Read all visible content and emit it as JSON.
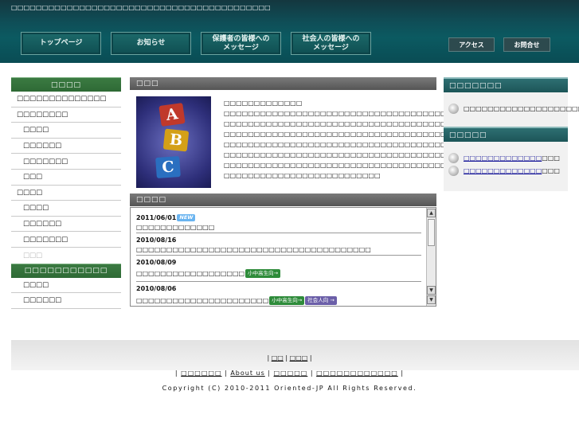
{
  "header": {
    "tagline": "□□□□□□□□□□□□□□□□□□□□□□□□□□□□□□□□□□□□□□□□□□",
    "nav": [
      {
        "label": "トップページ"
      },
      {
        "label": "お知らせ"
      },
      {
        "label_line1": "保護者の皆様への",
        "label_line2": "メッセージ"
      },
      {
        "label_line1": "社会人の皆様への",
        "label_line2": "メッセージ"
      }
    ],
    "access": "アクセス",
    "contact": "お問合せ"
  },
  "left_sidebar": {
    "heading": "□□□□",
    "items": [
      {
        "label": "□□□□□□□□□□□□□□",
        "style": "plain"
      },
      {
        "label": "□□□□□□□□",
        "style": "bold"
      },
      {
        "label": "□□□□",
        "style": "sub"
      },
      {
        "label": "□□□□□□",
        "style": "sub"
      },
      {
        "label": "□□□□□□□",
        "style": "sub"
      },
      {
        "label": "□□□",
        "style": "sub"
      },
      {
        "label": "□□□□",
        "style": "bold"
      },
      {
        "label": "□□□□",
        "style": "sub"
      },
      {
        "label": "□□□□□□",
        "style": "sub"
      },
      {
        "label": "□□□□□□□",
        "style": "sub"
      },
      {
        "label": "□□□",
        "style": "sub-disabled"
      }
    ],
    "heading2": "□□□□□□□□□□□",
    "items2": [
      {
        "label": "□□□□"
      },
      {
        "label": "□□□□□□"
      }
    ]
  },
  "center": {
    "greeting_heading": "□□□",
    "greeting_image_letters": [
      "A",
      "B",
      "C"
    ],
    "greeting_lines": [
      "□□□□□□□□□□□□□",
      "□□□□□□□□□□□□□□□□□□□□□□□□□□□□□□□□□□□□□□□",
      "□□□□□□□□□□□□□□□□□□□□□□□□□□□□□□□□□□□□□□□□□□□□□□□",
      "□□□□□□□□□□□□□□□□□□□□□□□□□□□□□□□□□□□□□□□□□□",
      "□□□□□□□□□□□□□□□□□□□□□□□□□□□□□□□□□□□□□□□□□",
      "□□□□□□□□□□□□□□□□□□□□□□□□□□□□□□□□□□□□□□□□□□□",
      "□□□□□□□□□□□□□□□□□□□□□□□□□□□□□□□□□□□□□□□□□□□□□□□□□",
      "□□□□□□□□□□□□□□□□□□□□□□□□□□"
    ],
    "news_heading": "□□□□",
    "news": [
      {
        "date": "2011/06/01",
        "tags": [
          {
            "text": "NEW",
            "kind": "new"
          }
        ],
        "text": "□□□□□□□□□□□□□",
        "text_tags": []
      },
      {
        "date": "2010/08/16",
        "tags": [],
        "text": "□□□□□□□□□□□□□□□□□□□□□□□□□□□□□□□□□□□□□□□",
        "text_tags": []
      },
      {
        "date": "2010/08/09",
        "tags": [],
        "text": "□□□□□□□□□□□□□□□□□□",
        "text_tags": [
          {
            "text": "小中高生向→",
            "kind": "green"
          }
        ]
      },
      {
        "date": "2010/08/06",
        "tags": [],
        "text": "□□□□□□□□□□□□□□□□□□□□□□",
        "text_tags": [
          {
            "text": "小中高生向→",
            "kind": "green"
          },
          {
            "text": "社会人向 →",
            "kind": "purple"
          }
        ]
      }
    ]
  },
  "right_sidebar": {
    "heading1": "□□□□□□□",
    "items1": [
      {
        "text": "□□□□□□□□□□□□□□□□□□□□",
        "link": ""
      }
    ],
    "heading2": "□□□□□",
    "items2": [
      {
        "link": "□□□□□□□□□□□□□",
        "text": "□□□"
      },
      {
        "link": "□□□□□□□□□□□□□",
        "text": "□□□"
      }
    ]
  },
  "footer": {
    "row1": [
      "□□",
      "□□□"
    ],
    "row2": [
      "□□□□□□",
      "About us",
      "□□□□□",
      "□□□□□□□□□□□□"
    ],
    "copyright": "Copyright (C) 2010-2011 Oriented-JP All Rights Reserved."
  },
  "colors": {
    "header_teal": "#0b5a61",
    "left_heading_green": "#2e6a35",
    "center_heading_gray": "#555555",
    "right_heading_teal": "#1c5558",
    "link_blue": "#1a1a9a"
  }
}
